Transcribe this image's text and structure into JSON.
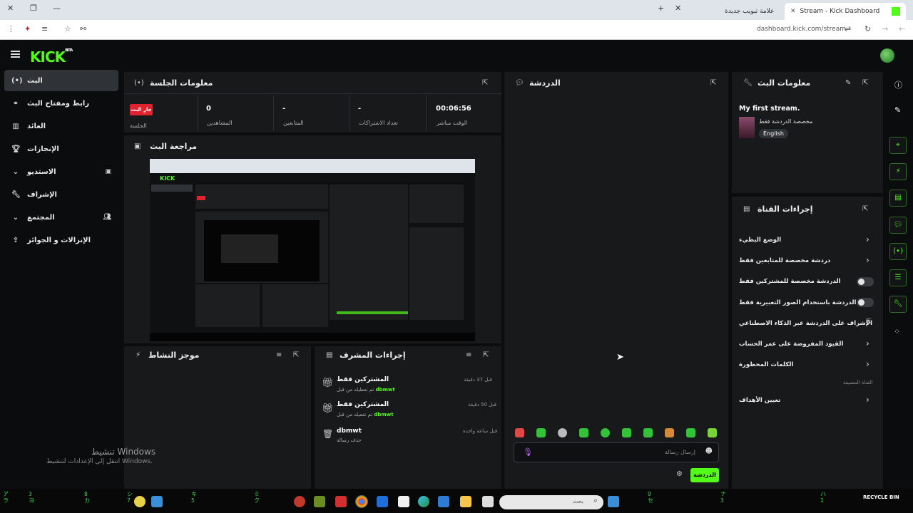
{
  "browser": {
    "tabs": [
      {
        "label": "Stream - Kick Dashboard",
        "active": true
      },
      {
        "label": "علامة تبويب جديدة",
        "active": false
      }
    ],
    "url": "dashboard.kick.com/stream"
  },
  "topbar": {
    "logo": "KICK",
    "badge": "BETA"
  },
  "sidebar": {
    "items": [
      {
        "label": "البث",
        "icon": "broadcast-icon",
        "active": true
      },
      {
        "label": "رابط ومفتاح البث",
        "icon": "link-icon"
      },
      {
        "label": "العائد",
        "icon": "chart-icon"
      },
      {
        "label": "الإنجازات",
        "icon": "trophy-icon"
      },
      {
        "label": "الاستديو",
        "icon": "studio-icon",
        "expand": true
      },
      {
        "label": "الإشراف",
        "icon": "wrench-icon"
      },
      {
        "label": "المجتمع",
        "icon": "community-icon",
        "expand": true
      },
      {
        "label": "الإنزالات و الجوائز",
        "icon": "drops-icon"
      }
    ]
  },
  "session": {
    "title": "معلومات الجلسة",
    "live_badge": "جارِ البث",
    "stats": [
      {
        "value": "00:06:56",
        "label": "الوقت مباشر"
      },
      {
        "value": "-",
        "label": "تعداد الاشتراكات"
      },
      {
        "value": "-",
        "label": "المتابعين"
      },
      {
        "value": "0",
        "label": "المشاهدين"
      },
      {
        "value": "",
        "label": "الجلسة"
      }
    ]
  },
  "preview": {
    "title": "مراجعة البث"
  },
  "chat": {
    "title": "الدردشة",
    "input_placeholder": "إرسال رسالة",
    "send_label": "الدردشة"
  },
  "stream_info": {
    "title": "معلومات البث",
    "stream_title": "My first stream.",
    "category": "مخصصة الدردشة فقط",
    "language": "English"
  },
  "channel_actions": {
    "title": "إجراءات القناة",
    "items": [
      {
        "label": "الوضع البطيء",
        "type": "chevron"
      },
      {
        "label": "دردشة مخصصة للمتابعين فقط",
        "type": "chevron"
      },
      {
        "label": "الدردشة مخصصة للمشتركين فقط",
        "type": "toggle"
      },
      {
        "label": "الدردشة باستخدام الصور التعبيرية فقط",
        "type": "toggle"
      },
      {
        "label": "الإشراف على الدردشة عبر الذكاء الاصطناعي",
        "type": "external"
      },
      {
        "label": "القيود المفروضة على عمر الحساب",
        "type": "chevron"
      },
      {
        "label": "الكلمات المحظورة",
        "type": "chevron"
      }
    ],
    "section_label": "القناة المضيفة",
    "goals_label": "تعيين الأهداف"
  },
  "activity": {
    "title": "موجز النشاط"
  },
  "mod_actions": {
    "title": "إجراءات المشرف",
    "items": [
      {
        "title": "المشتركين فقط",
        "action": "تم تعطيله من قبل",
        "user": "dbmwt",
        "time": "قبل 37 دقيقة",
        "icon": "gift-icon"
      },
      {
        "title": "المشتركين فقط",
        "action": "تم تفعيله من قبل",
        "user": "dbmwt",
        "time": "قبل 50 دقيقة",
        "icon": "gift-icon"
      },
      {
        "title": "dbmwt",
        "action": "حذف رسالة",
        "user": "",
        "time": "قبل ساعة واحدة",
        "icon": "trash-icon"
      }
    ]
  },
  "watermark": {
    "line1": "تنشيط Windows",
    "line2": "انتقل إلى الإعدادات لتنشيط Windows."
  },
  "taskbar": {
    "search_placeholder": "بحث",
    "recycle": "RECYCLE BIN"
  },
  "colors": {
    "accent": "#53fc18",
    "live": "#e0212e",
    "panel": "#18191b",
    "background": "#0b0c0d"
  }
}
